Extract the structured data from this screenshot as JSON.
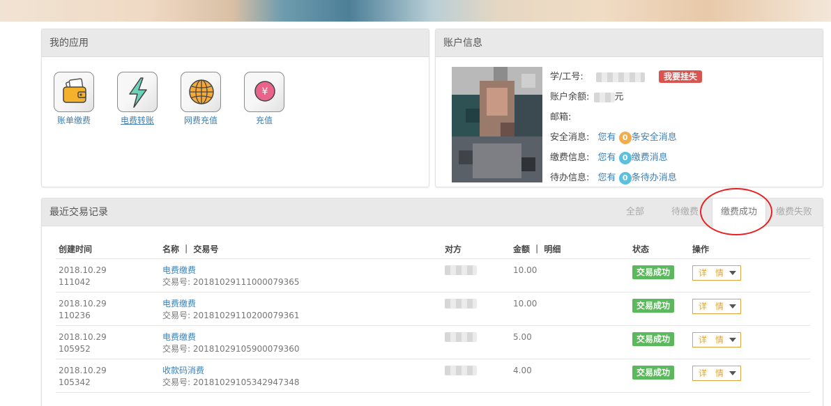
{
  "apps_panel": {
    "title": "我的应用",
    "items": [
      {
        "label": "账单缴费",
        "icon": "wallet-icon"
      },
      {
        "label": "电费转账",
        "icon": "lightning-icon"
      },
      {
        "label": "网费充值",
        "icon": "globe-icon"
      },
      {
        "label": "充值",
        "icon": "yen-coin-icon"
      }
    ]
  },
  "account_panel": {
    "title": "账户信息",
    "student_id_label": "学/工号:",
    "report_loss_button": "我要挂失",
    "balance_label": "账户余额:",
    "balance_unit": "元",
    "email_label": "邮箱:",
    "security_label": "安全消息:",
    "security_prefix": "您有",
    "security_count": "0",
    "security_suffix": "条安全消息",
    "payment_label": "缴费信息:",
    "payment_prefix": "您有",
    "payment_count": "0",
    "payment_suffix": "缴费消息",
    "todo_label": "待办信息:",
    "todo_prefix": "您有",
    "todo_count": "0",
    "todo_suffix": "条待办消息",
    "colors": {
      "security_badge": "#f0ad4e",
      "info_badge": "#5bc0de"
    }
  },
  "records_panel": {
    "title": "最近交易记录",
    "tabs": [
      {
        "label": "全部",
        "active": false
      },
      {
        "label": "待缴费",
        "active": false
      },
      {
        "label": "缴费成功",
        "active": true
      },
      {
        "label": "缴费失败",
        "active": false
      }
    ],
    "headers": {
      "created": "创建时间",
      "name": "名称 ｜ 交易号",
      "counterparty": "对方",
      "amount": "金额 ｜ 明细",
      "status": "状态",
      "action": "操作"
    },
    "rows": [
      {
        "date": "2018.10.29",
        "time": "111042",
        "name": "电费缴费",
        "txn": "交易号: 20181029111000079365",
        "amount": "10.00",
        "status": "交易成功",
        "action": "详　情"
      },
      {
        "date": "2018.10.29",
        "time": "110236",
        "name": "电费缴费",
        "txn": "交易号: 20181029110200079361",
        "amount": "10.00",
        "status": "交易成功",
        "action": "详　情"
      },
      {
        "date": "2018.10.29",
        "time": "105952",
        "name": "电费缴费",
        "txn": "交易号: 20181029105900079360",
        "amount": "5.00",
        "status": "交易成功",
        "action": "详　情"
      },
      {
        "date": "2018.10.29",
        "time": "105342",
        "name": "收款码消费",
        "txn": "交易号: 20181029105342947348",
        "amount": "4.00",
        "status": "交易成功",
        "action": "详　情"
      }
    ]
  }
}
